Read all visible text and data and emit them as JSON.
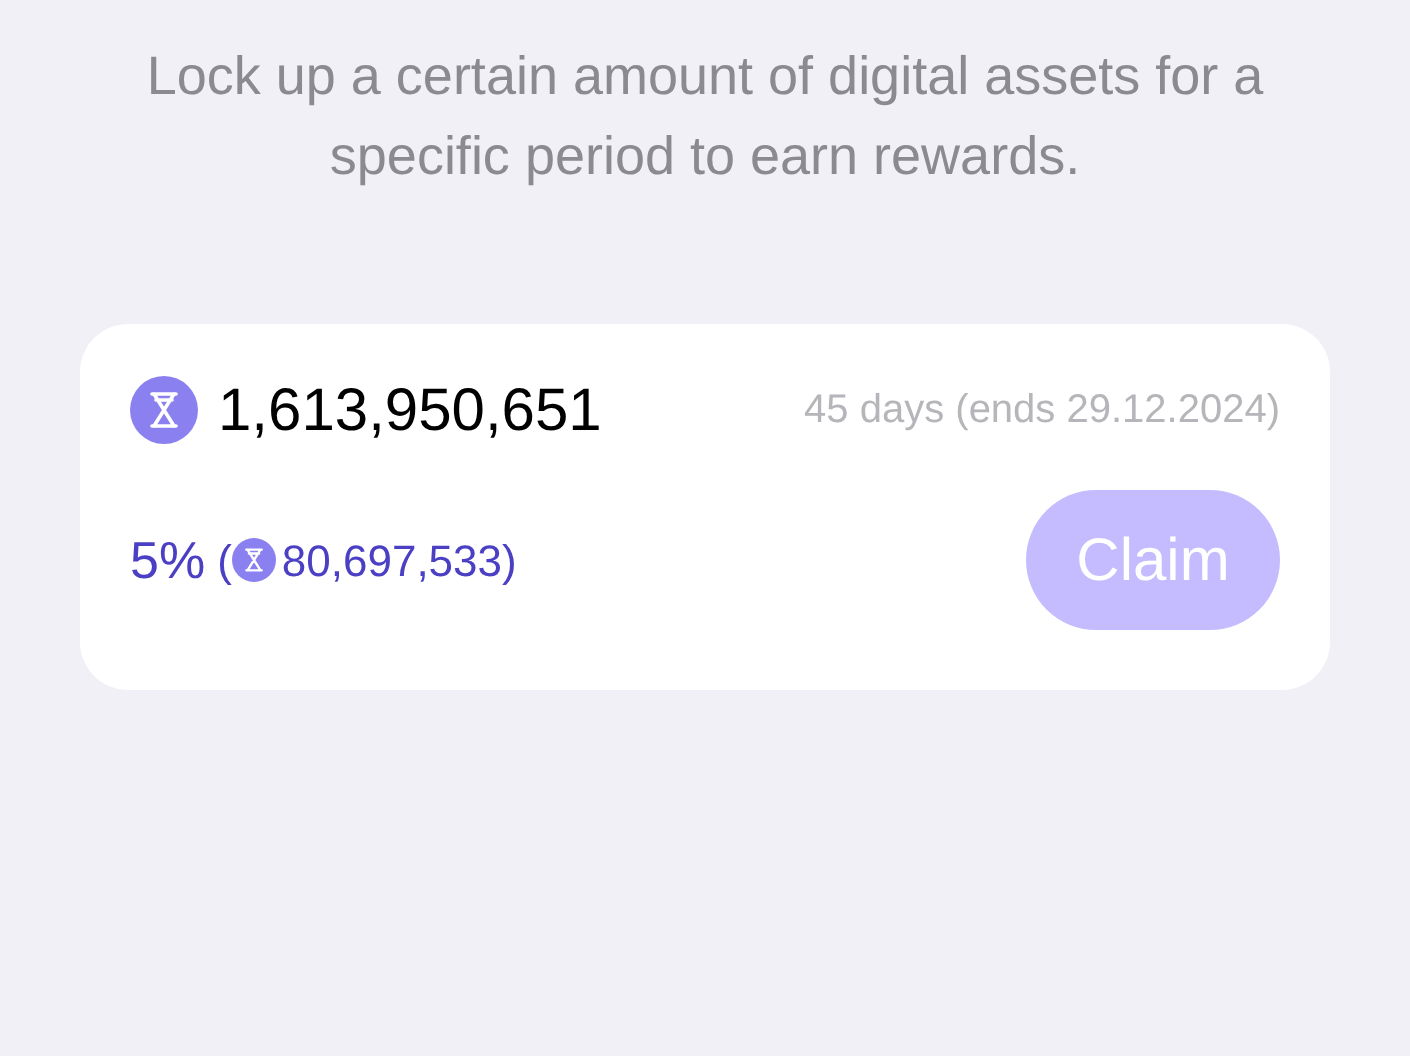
{
  "description": "Lock up a certain amount of digital assets for a specific period to earn rewards.",
  "stake": {
    "amount": "1,613,950,651",
    "term": "45 days (ends 29.12.2024)",
    "rate": "5%",
    "reward_open": "(",
    "reward": "80,697,533)"
  },
  "claim_button": {
    "label": "Claim",
    "disabled": true
  }
}
